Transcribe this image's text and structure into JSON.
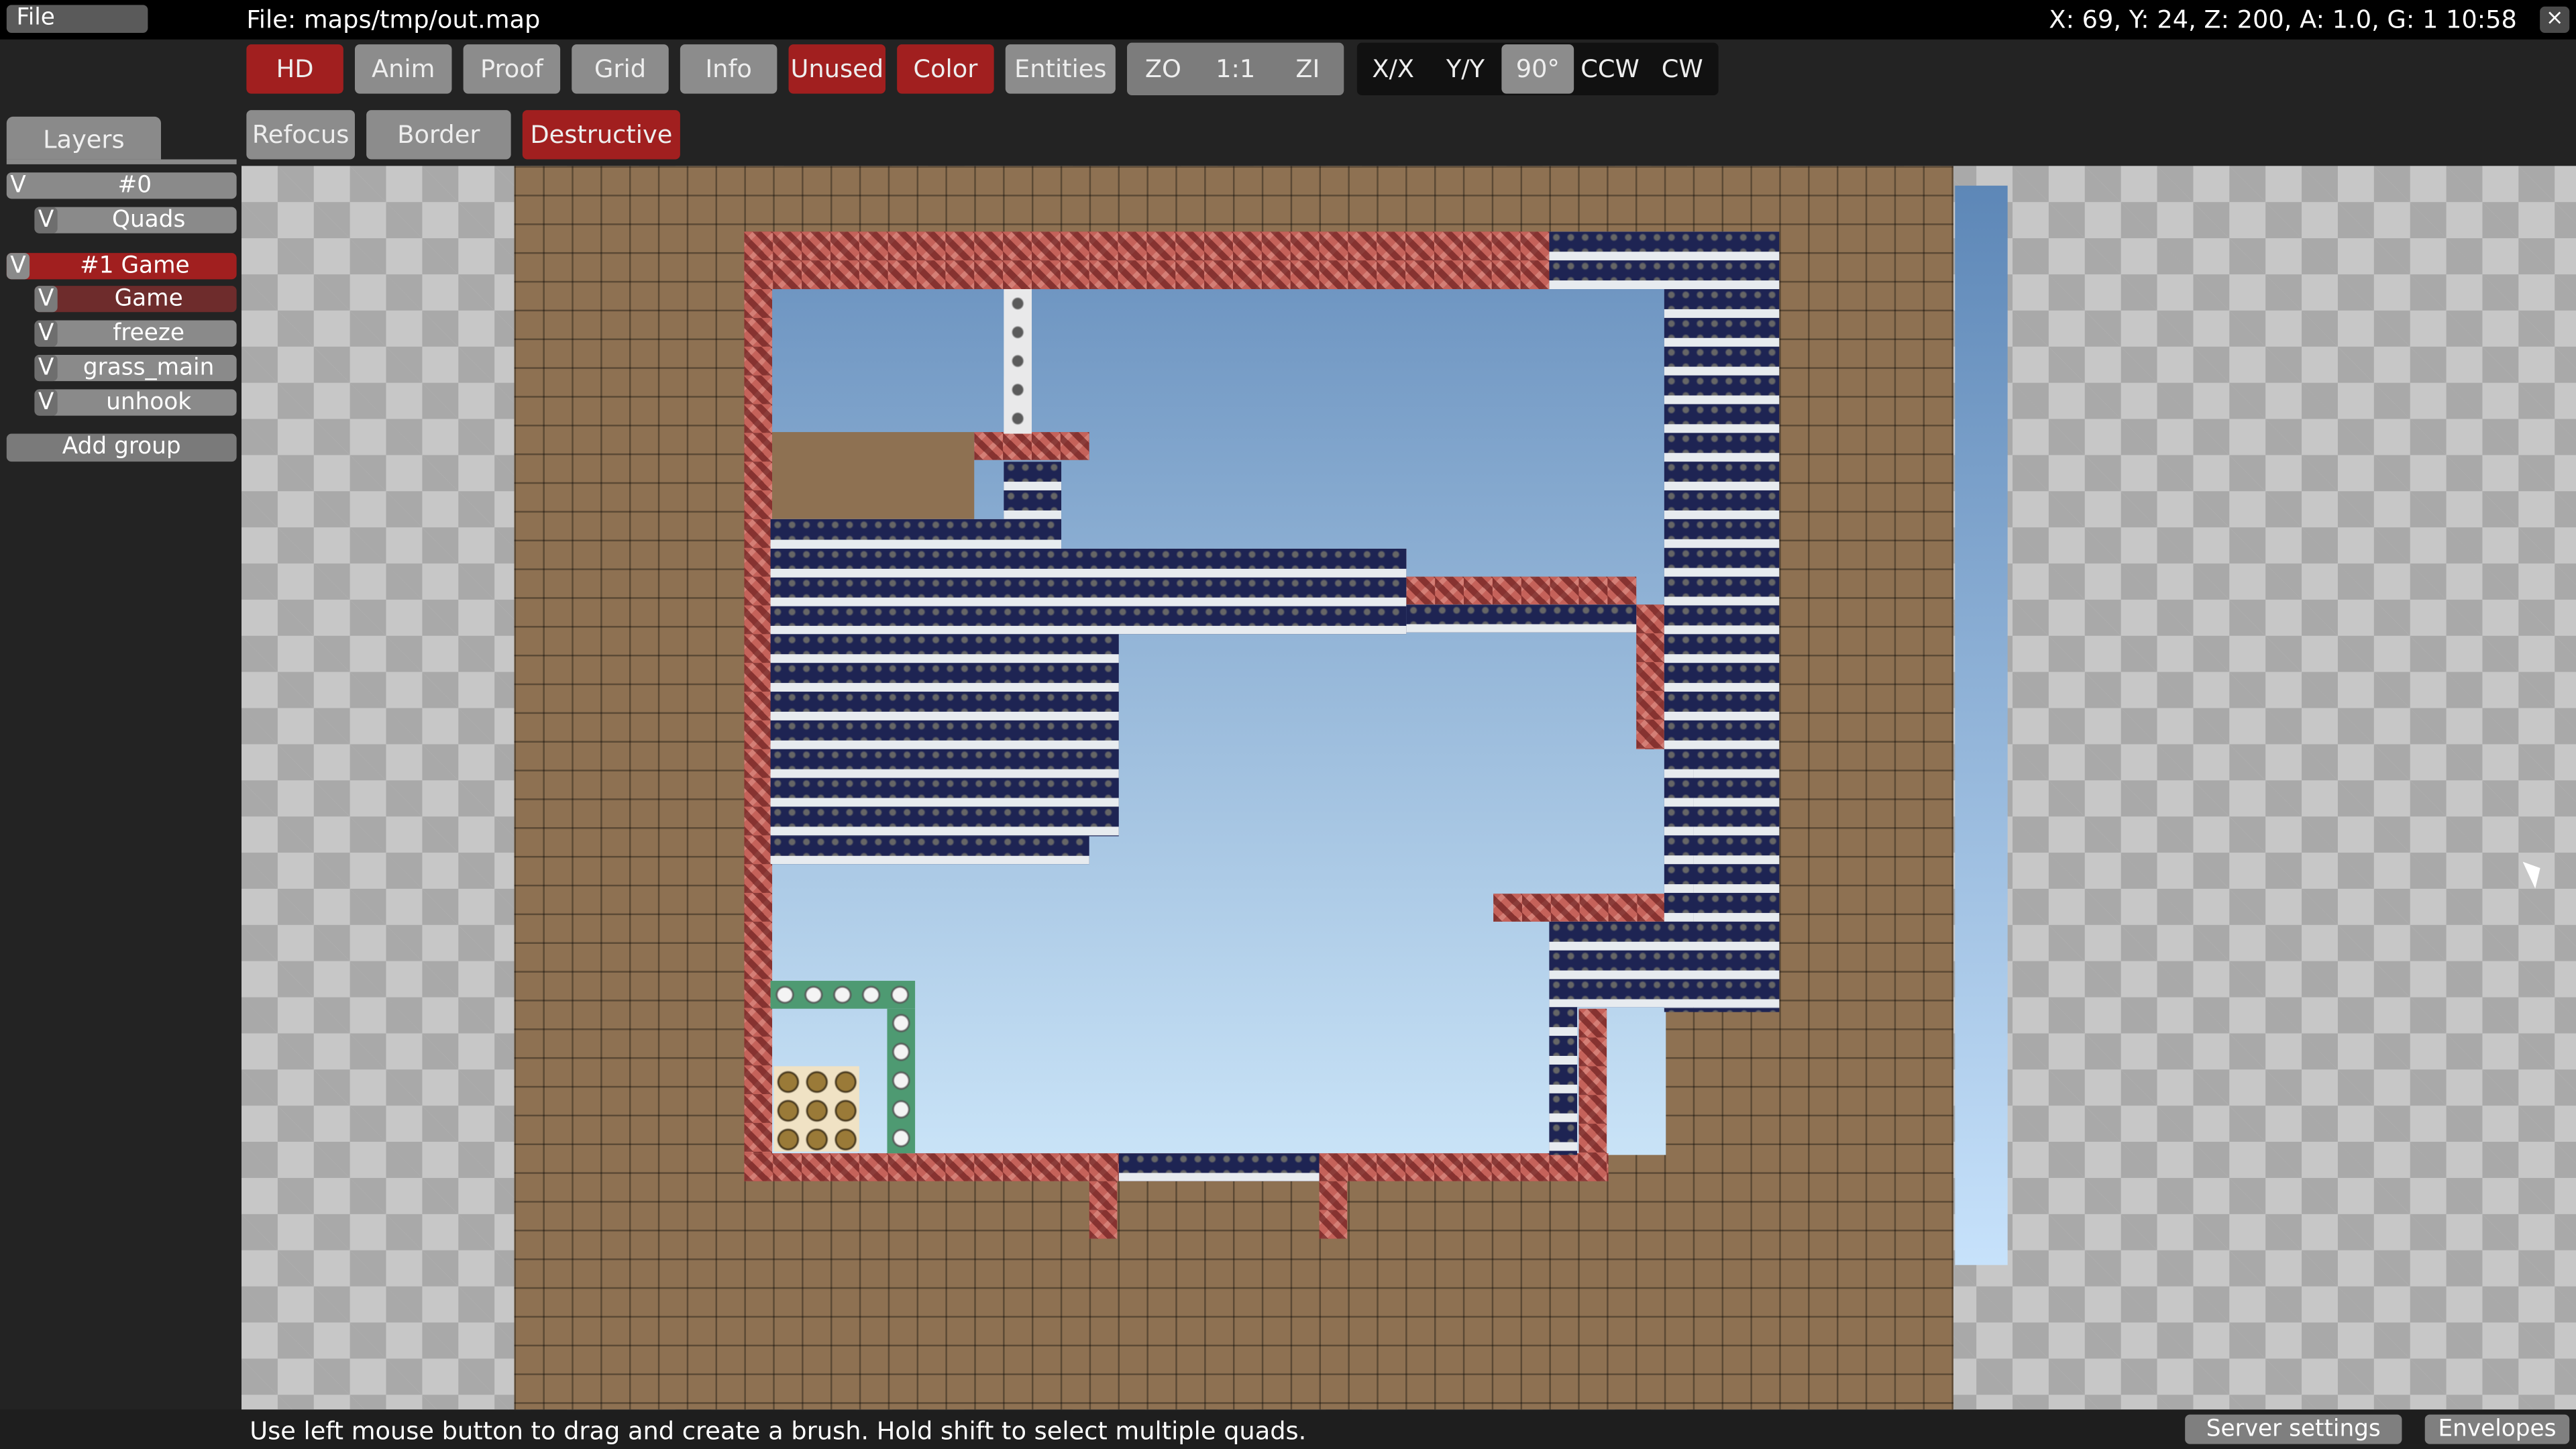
{
  "menu": {
    "file": "File"
  },
  "window": {
    "title": "File: maps/tmp/out.map",
    "status": "X: 69, Y: 24, Z: 200, A: 1.0, G: 1  10:58",
    "close": "×"
  },
  "toolbar": {
    "hd": "HD",
    "anim": "Anim",
    "proof": "Proof",
    "grid": "Grid",
    "info": "Info",
    "unused": "Unused",
    "color": "Color",
    "entities": "Entities",
    "zoom_out": "ZO",
    "zoom_reset": "1:1",
    "zoom_in": "ZI",
    "flip_x": "X/X",
    "flip_y": "Y/Y",
    "rotate_90": "90°",
    "ccw": "CCW",
    "cw": "CW",
    "refocus": "Refocus",
    "border": "Border",
    "destructive": "Destructive"
  },
  "layers": {
    "tab": "Layers",
    "groups": [
      {
        "visible": "V",
        "name": "#0",
        "selected": false,
        "layers": [
          {
            "visible": "V",
            "name": "Quads"
          }
        ]
      },
      {
        "visible": "V",
        "name": "#1 Game",
        "selected": true,
        "layers": [
          {
            "visible": "V",
            "name": "Game"
          },
          {
            "visible": "V",
            "name": "freeze"
          },
          {
            "visible": "V",
            "name": "grass_main"
          },
          {
            "visible": "V",
            "name": "unhook"
          }
        ]
      }
    ],
    "add_group": "Add group"
  },
  "footer": {
    "hint": "Use left mouse button to drag and create a brush. Hold shift to select multiple quads.",
    "server_settings": "Server settings",
    "envelopes": "Envelopes"
  }
}
